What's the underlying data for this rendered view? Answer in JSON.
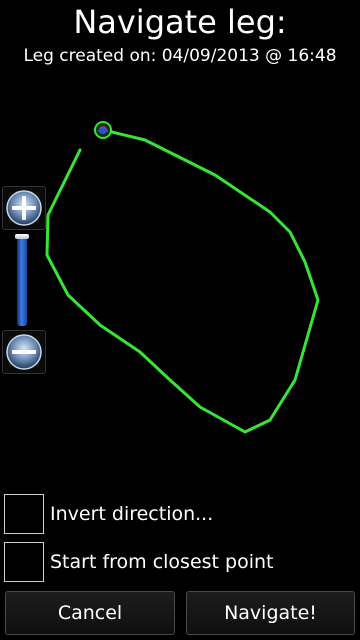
{
  "header": {
    "title": "Navigate leg:",
    "subtitle": "Leg created on: 04/09/2013 @ 16:48"
  },
  "map": {
    "route_color": "#35e635",
    "marker_color": "#2a54d6",
    "zoom_in_icon": "zoom-in-plus-icon",
    "zoom_out_icon": "zoom-out-minus-icon"
  },
  "options": [
    {
      "label": "Invert direction...",
      "checked": false
    },
    {
      "label": "Start from closest point",
      "checked": false
    }
  ],
  "buttons": {
    "cancel": "Cancel",
    "navigate": "Navigate!"
  }
}
